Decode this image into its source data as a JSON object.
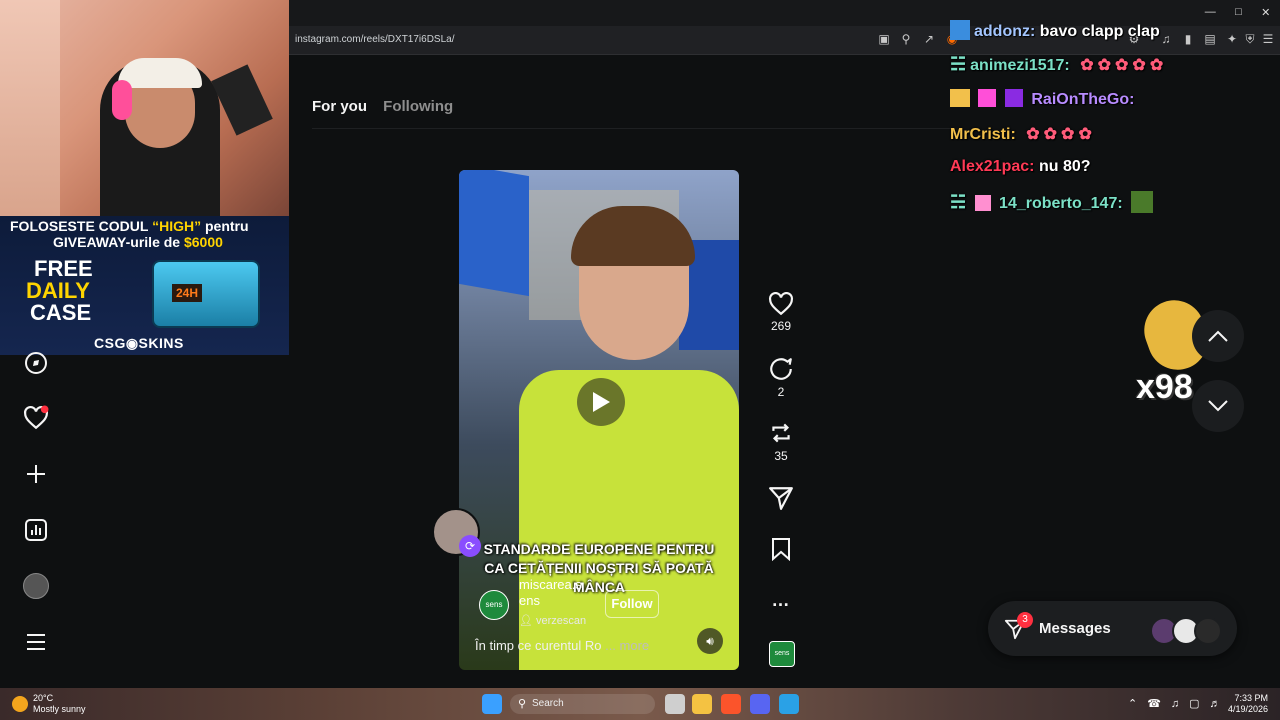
{
  "browser": {
    "url": "instagram.com/reels/DXT17i6DSLa/",
    "window_controls": [
      "minimize",
      "maximize",
      "close"
    ]
  },
  "feed": {
    "tabs": [
      {
        "label": "For you",
        "active": true
      },
      {
        "label": "Following",
        "active": false
      }
    ]
  },
  "webcam_promo": {
    "line1_prefix": "FOLOSESTE CODUL ",
    "code": "“HIGH”",
    "line1_suffix": " pentru",
    "line2_prefix": "GIVEAWAY-urile de ",
    "amount": "$6000",
    "free": "FREE",
    "daily": "DAILY",
    "case": "CASE",
    "timer": "24H",
    "brand": "CSG◉SKINS"
  },
  "reel": {
    "caption_line1": "STANDARDE EUROPENE PENTRU",
    "caption_line2": "CA CETĂȚENII NOȘTRI SĂ POATĂ MÂNCA",
    "author_line1": "miscarea.s",
    "author_line2": "ens",
    "collab": "verzescan",
    "follow_label": "Follow",
    "description": "În timp ce curentul Ro",
    "more_label": "... more",
    "watermark": "sens"
  },
  "actions": {
    "likes": "269",
    "comments": "2",
    "reposts": "35"
  },
  "chat": {
    "messages": [
      {
        "user": "addonz:",
        "text": "bavo clapp clap",
        "color": "#a4c6ff"
      },
      {
        "user": "animezi1517:",
        "text": "",
        "color": "#7be0c6"
      },
      {
        "user": "RaiOnTheGo:",
        "text": "",
        "color": "#b88cff"
      },
      {
        "user": "MrCristi:",
        "text": "",
        "color": "#f2c04b"
      },
      {
        "user": "Alex21pac:",
        "text": "nu 80?",
        "color": "#ff3a56"
      },
      {
        "user": "14_roberto_147:",
        "text": "",
        "color": "#7be0c6"
      }
    ],
    "emote_count": "x98"
  },
  "messages_pill": {
    "label": "Messages",
    "badge": "3"
  },
  "taskbar": {
    "weather_temp": "20°C",
    "weather_desc": "Mostly sunny",
    "search_label": "Search",
    "time": "7:33 PM",
    "date": "4/19/2026"
  }
}
